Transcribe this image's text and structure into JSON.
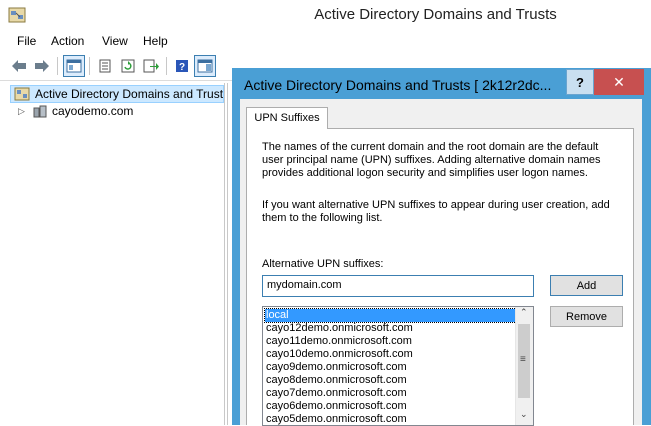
{
  "window": {
    "title": "Active Directory Domains and Trusts"
  },
  "menu": [
    "File",
    "Action",
    "View",
    "Help"
  ],
  "toolbar": {
    "icons": [
      "back-arrow-icon",
      "forward-arrow-icon",
      "console-tree-icon",
      "properties-icon",
      "refresh-icon",
      "export-list-icon",
      "help-icon",
      "show-action-pane-icon"
    ]
  },
  "tree": {
    "root_label": "Active Directory Domains and Trust",
    "child_label": "cayodemo.com"
  },
  "dialog": {
    "title": "Active Directory Domains and Trusts [ 2k12r2dc...",
    "help_label": "?",
    "close_label": "✕",
    "tab_label": "UPN Suffixes",
    "para1": "The names of the current domain and the root domain are the default user principal name (UPN) suffixes. Adding alternative domain names provides additional logon security and simplifies user logon names.",
    "para2": "If you want alternative UPN suffixes to appear during user creation, add them to the following list.",
    "field_label": "Alternative UPN suffixes:",
    "input_value": "mydomain.com",
    "add_label": "Add",
    "remove_label": "Remove",
    "suffixes": [
      "local",
      "cayo12demo.onmicrosoft.com",
      "cayo11demo.onmicrosoft.com",
      "cayo10demo.onmicrosoft.com",
      "cayo9demo.onmicrosoft.com",
      "cayo8demo.onmicrosoft.com",
      "cayo7demo.onmicrosoft.com",
      "cayo6demo.onmicrosoft.com",
      "cayo5demo.onmicrosoft.com"
    ],
    "selected_index": 0
  },
  "colors": {
    "dialog_border": "#4a9fd5",
    "close_red": "#c75050",
    "selection": "#3399ff"
  }
}
